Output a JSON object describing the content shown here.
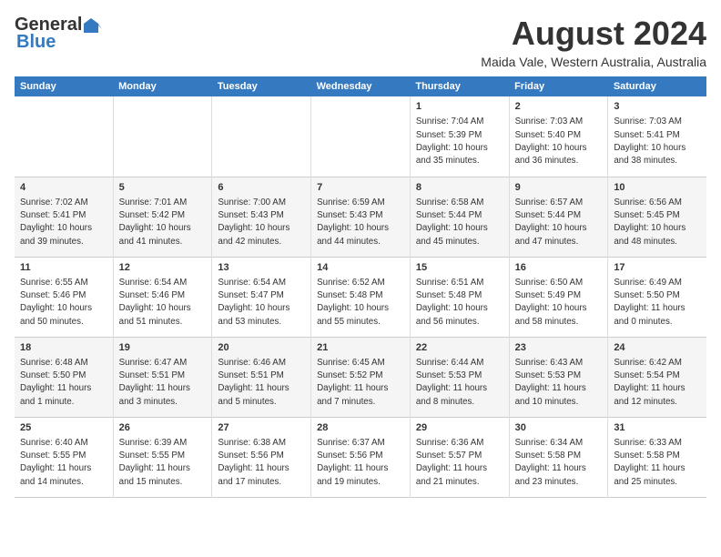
{
  "logo": {
    "general": "General",
    "blue": "Blue"
  },
  "title": "August 2024",
  "subtitle": "Maida Vale, Western Australia, Australia",
  "days_of_week": [
    "Sunday",
    "Monday",
    "Tuesday",
    "Wednesday",
    "Thursday",
    "Friday",
    "Saturday"
  ],
  "weeks": [
    [
      {
        "day": "",
        "content": ""
      },
      {
        "day": "",
        "content": ""
      },
      {
        "day": "",
        "content": ""
      },
      {
        "day": "",
        "content": ""
      },
      {
        "day": "1",
        "content": "Sunrise: 7:04 AM\nSunset: 5:39 PM\nDaylight: 10 hours\nand 35 minutes."
      },
      {
        "day": "2",
        "content": "Sunrise: 7:03 AM\nSunset: 5:40 PM\nDaylight: 10 hours\nand 36 minutes."
      },
      {
        "day": "3",
        "content": "Sunrise: 7:03 AM\nSunset: 5:41 PM\nDaylight: 10 hours\nand 38 minutes."
      }
    ],
    [
      {
        "day": "4",
        "content": "Sunrise: 7:02 AM\nSunset: 5:41 PM\nDaylight: 10 hours\nand 39 minutes."
      },
      {
        "day": "5",
        "content": "Sunrise: 7:01 AM\nSunset: 5:42 PM\nDaylight: 10 hours\nand 41 minutes."
      },
      {
        "day": "6",
        "content": "Sunrise: 7:00 AM\nSunset: 5:43 PM\nDaylight: 10 hours\nand 42 minutes."
      },
      {
        "day": "7",
        "content": "Sunrise: 6:59 AM\nSunset: 5:43 PM\nDaylight: 10 hours\nand 44 minutes."
      },
      {
        "day": "8",
        "content": "Sunrise: 6:58 AM\nSunset: 5:44 PM\nDaylight: 10 hours\nand 45 minutes."
      },
      {
        "day": "9",
        "content": "Sunrise: 6:57 AM\nSunset: 5:44 PM\nDaylight: 10 hours\nand 47 minutes."
      },
      {
        "day": "10",
        "content": "Sunrise: 6:56 AM\nSunset: 5:45 PM\nDaylight: 10 hours\nand 48 minutes."
      }
    ],
    [
      {
        "day": "11",
        "content": "Sunrise: 6:55 AM\nSunset: 5:46 PM\nDaylight: 10 hours\nand 50 minutes."
      },
      {
        "day": "12",
        "content": "Sunrise: 6:54 AM\nSunset: 5:46 PM\nDaylight: 10 hours\nand 51 minutes."
      },
      {
        "day": "13",
        "content": "Sunrise: 6:54 AM\nSunset: 5:47 PM\nDaylight: 10 hours\nand 53 minutes."
      },
      {
        "day": "14",
        "content": "Sunrise: 6:52 AM\nSunset: 5:48 PM\nDaylight: 10 hours\nand 55 minutes."
      },
      {
        "day": "15",
        "content": "Sunrise: 6:51 AM\nSunset: 5:48 PM\nDaylight: 10 hours\nand 56 minutes."
      },
      {
        "day": "16",
        "content": "Sunrise: 6:50 AM\nSunset: 5:49 PM\nDaylight: 10 hours\nand 58 minutes."
      },
      {
        "day": "17",
        "content": "Sunrise: 6:49 AM\nSunset: 5:50 PM\nDaylight: 11 hours\nand 0 minutes."
      }
    ],
    [
      {
        "day": "18",
        "content": "Sunrise: 6:48 AM\nSunset: 5:50 PM\nDaylight: 11 hours\nand 1 minute."
      },
      {
        "day": "19",
        "content": "Sunrise: 6:47 AM\nSunset: 5:51 PM\nDaylight: 11 hours\nand 3 minutes."
      },
      {
        "day": "20",
        "content": "Sunrise: 6:46 AM\nSunset: 5:51 PM\nDaylight: 11 hours\nand 5 minutes."
      },
      {
        "day": "21",
        "content": "Sunrise: 6:45 AM\nSunset: 5:52 PM\nDaylight: 11 hours\nand 7 minutes."
      },
      {
        "day": "22",
        "content": "Sunrise: 6:44 AM\nSunset: 5:53 PM\nDaylight: 11 hours\nand 8 minutes."
      },
      {
        "day": "23",
        "content": "Sunrise: 6:43 AM\nSunset: 5:53 PM\nDaylight: 11 hours\nand 10 minutes."
      },
      {
        "day": "24",
        "content": "Sunrise: 6:42 AM\nSunset: 5:54 PM\nDaylight: 11 hours\nand 12 minutes."
      }
    ],
    [
      {
        "day": "25",
        "content": "Sunrise: 6:40 AM\nSunset: 5:55 PM\nDaylight: 11 hours\nand 14 minutes."
      },
      {
        "day": "26",
        "content": "Sunrise: 6:39 AM\nSunset: 5:55 PM\nDaylight: 11 hours\nand 15 minutes."
      },
      {
        "day": "27",
        "content": "Sunrise: 6:38 AM\nSunset: 5:56 PM\nDaylight: 11 hours\nand 17 minutes."
      },
      {
        "day": "28",
        "content": "Sunrise: 6:37 AM\nSunset: 5:56 PM\nDaylight: 11 hours\nand 19 minutes."
      },
      {
        "day": "29",
        "content": "Sunrise: 6:36 AM\nSunset: 5:57 PM\nDaylight: 11 hours\nand 21 minutes."
      },
      {
        "day": "30",
        "content": "Sunrise: 6:34 AM\nSunset: 5:58 PM\nDaylight: 11 hours\nand 23 minutes."
      },
      {
        "day": "31",
        "content": "Sunrise: 6:33 AM\nSunset: 5:58 PM\nDaylight: 11 hours\nand 25 minutes."
      }
    ]
  ]
}
